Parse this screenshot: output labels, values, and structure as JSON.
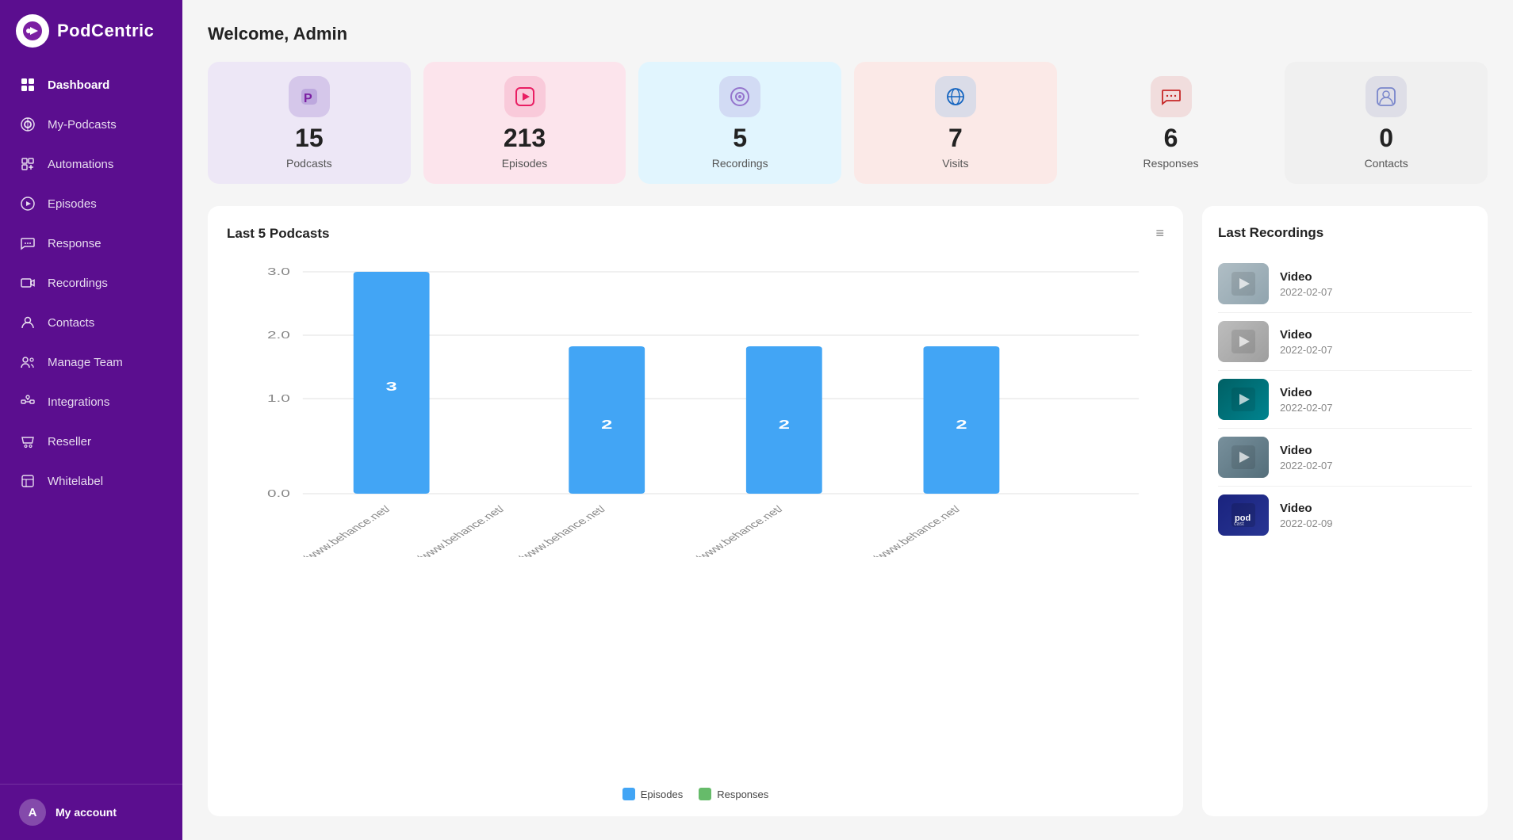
{
  "sidebar": {
    "logo_text": "PodCentric",
    "nav_items": [
      {
        "id": "dashboard",
        "label": "Dashboard",
        "active": true
      },
      {
        "id": "my-podcasts",
        "label": "My-Podcasts",
        "active": false
      },
      {
        "id": "automations",
        "label": "Automations",
        "active": false
      },
      {
        "id": "episodes",
        "label": "Episodes",
        "active": false
      },
      {
        "id": "response",
        "label": "Response",
        "active": false
      },
      {
        "id": "recordings",
        "label": "Recordings",
        "active": false
      },
      {
        "id": "contacts",
        "label": "Contacts",
        "active": false
      },
      {
        "id": "manage-team",
        "label": "Manage Team",
        "active": false
      },
      {
        "id": "integrations",
        "label": "Integrations",
        "active": false
      },
      {
        "id": "reseller",
        "label": "Reseller",
        "active": false
      },
      {
        "id": "whitelabel",
        "label": "Whitelabel",
        "active": false
      }
    ],
    "account_label": "My account",
    "account_initial": "A"
  },
  "header": {
    "welcome_text": "Welcome, Admin"
  },
  "stats": [
    {
      "id": "podcasts",
      "number": "15",
      "label": "Podcasts",
      "card_class": "purple",
      "icon_class": "purple-bg",
      "icon": "🅿"
    },
    {
      "id": "episodes",
      "number": "213",
      "label": "Episodes",
      "card_class": "pink",
      "icon_class": "pink-bg",
      "icon": "▶"
    },
    {
      "id": "recordings",
      "number": "5",
      "label": "Recordings",
      "card_class": "light-blue",
      "icon_class": "lilac-bg",
      "icon": "◈"
    },
    {
      "id": "visits",
      "number": "7",
      "label": "Visits",
      "card_class": "peach",
      "icon_class": "blue-bg",
      "icon": "🌐"
    },
    {
      "id": "responses",
      "number": "6",
      "label": "Responses",
      "card_class": "gray",
      "icon_class": "chat-bg",
      "icon": "💬"
    },
    {
      "id": "contacts",
      "number": "0",
      "label": "Contacts",
      "card_class": "light-gray",
      "icon_class": "contact-bg",
      "icon": "👤"
    }
  ],
  "chart": {
    "title": "Last 5 Podcasts",
    "menu_icon": "≡",
    "y_labels": [
      "3.0",
      "2.0",
      "1.0",
      "0.0"
    ],
    "bars": [
      {
        "x_label": "https://www.behance.net/",
        "episodes": 3,
        "responses": 0
      },
      {
        "x_label": "https://www.behance.net/",
        "episodes": 0,
        "responses": 0
      },
      {
        "x_label": "https://www.behance.net/",
        "episodes": 2,
        "responses": 0
      },
      {
        "x_label": "https://www.behance.net/",
        "episodes": 2,
        "responses": 0
      },
      {
        "x_label": "https://www.behance.net/",
        "episodes": 2,
        "responses": 0
      }
    ],
    "legend": [
      {
        "label": "Episodes",
        "color": "#42a5f5"
      },
      {
        "label": "Responses",
        "color": "#66bb6a"
      }
    ]
  },
  "recordings_panel": {
    "title": "Last Recordings",
    "items": [
      {
        "name": "Video",
        "date": "2022-02-07",
        "thumb_class": "thumb-1"
      },
      {
        "name": "Video",
        "date": "2022-02-07",
        "thumb_class": "thumb-2"
      },
      {
        "name": "Video",
        "date": "2022-02-07",
        "thumb_class": "thumb-3"
      },
      {
        "name": "Video",
        "date": "2022-02-07",
        "thumb_class": "thumb-4"
      },
      {
        "name": "Video",
        "date": "2022-02-09",
        "thumb_class": "thumb-5"
      }
    ]
  }
}
